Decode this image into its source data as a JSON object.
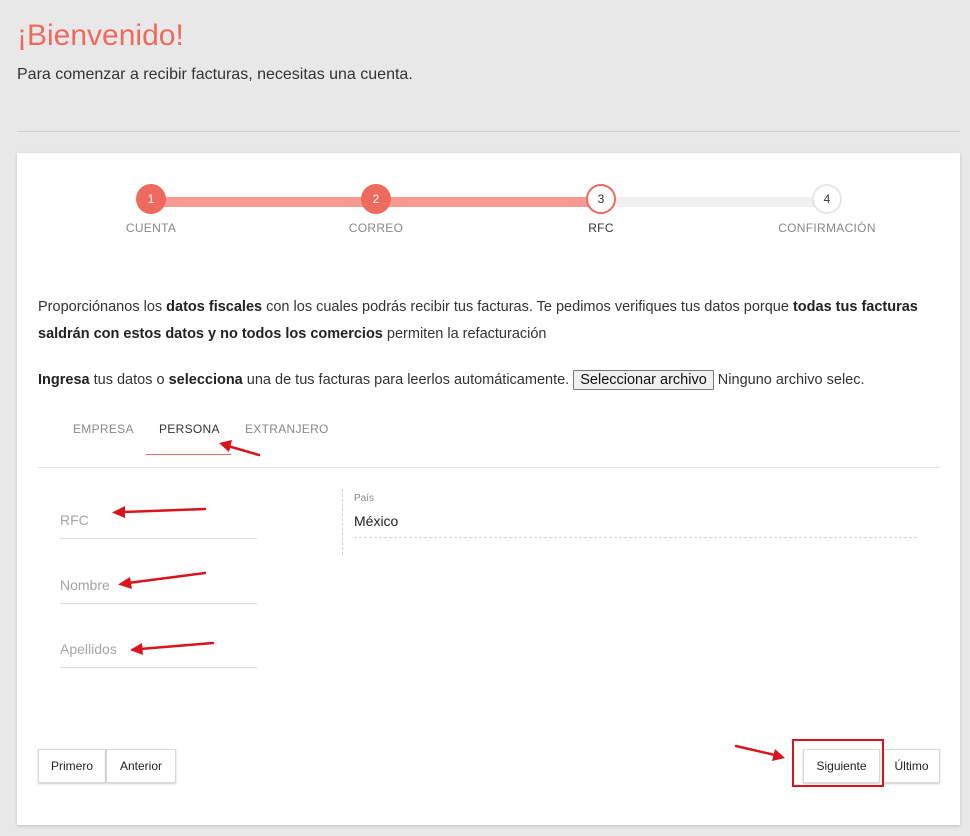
{
  "header": {
    "title": "¡Bienvenido!",
    "subtitle": "Para comenzar a recibir facturas, necesitas una cuenta."
  },
  "stepper": {
    "current_step": 3,
    "steps": [
      {
        "number": "1",
        "label": "CUENTA",
        "state": "done"
      },
      {
        "number": "2",
        "label": "CORREO",
        "state": "done"
      },
      {
        "number": "3",
        "label": "RFC",
        "state": "active"
      },
      {
        "number": "4",
        "label": "CONFIRMACIÓN",
        "state": "todo"
      }
    ]
  },
  "intro": {
    "part1": "Proporciónanos los ",
    "bold1": "datos fiscales",
    "part2": " con los cuales podrás recibir tus facturas. Te pedimos verifiques tus datos porque ",
    "bold2": "todas tus facturas saldrán con estos datos y no todos los comercios",
    "part3": " permiten la refacturación"
  },
  "file_upload": {
    "bold1": "Ingresa",
    "text1": " tus datos o ",
    "bold2": "selecciona",
    "text2": " una de tus facturas para leerlos automáticamente. ",
    "button_label": "Seleccionar archivo",
    "status": " Ninguno archivo selec."
  },
  "tabs": [
    {
      "label": "EMPRESA",
      "active": false
    },
    {
      "label": "PERSONA",
      "active": true
    },
    {
      "label": "EXTRANJERO",
      "active": false
    }
  ],
  "form": {
    "rfc_placeholder": "RFC",
    "nombre_placeholder": "Nombre",
    "apellidos_placeholder": "Apellidos",
    "country_label": "País",
    "country_value": "México"
  },
  "buttons": {
    "first": "Primero",
    "previous": "Anterior",
    "next": "Siguiente",
    "last": "Último"
  },
  "colors": {
    "accent": "#ee6a5f",
    "annotation": "#d9141d"
  }
}
